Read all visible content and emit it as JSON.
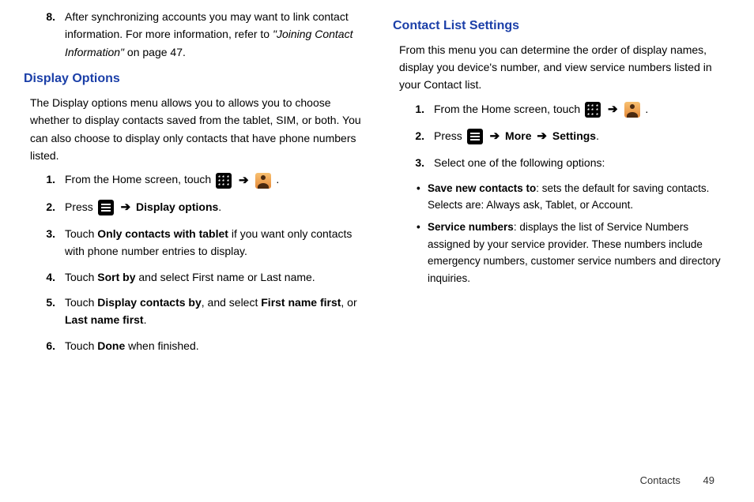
{
  "left": {
    "prestep_num": "8.",
    "prestep_a": "After synchronizing accounts you may want to link contact information. For more information, refer to ",
    "prestep_ref": "\"Joining Contact Information\"",
    "prestep_b": " on page 47.",
    "heading": "Display Options",
    "intro": "The Display options menu allows you to allows you to choose whether to display contacts saved from the tablet, SIM, or both. You can also choose to display only contacts that have phone numbers listed.",
    "s1_num": "1.",
    "s1_a": "From the Home screen, touch ",
    "arrow": "➔",
    "period": ".",
    "s2_num": "2.",
    "s2_a": "Press ",
    "s2_b": "Display options",
    "s3_num": "3.",
    "s3_a": "Touch ",
    "s3_b": "Only contacts with tablet",
    "s3_c": " if you want only contacts with phone number entries to display.",
    "s4_num": "4.",
    "s4_a": "Touch ",
    "s4_b": "Sort by",
    "s4_c": " and select First name or Last name.",
    "s5_num": "5.",
    "s5_a": "Touch ",
    "s5_b": "Display contacts by",
    "s5_c": ", and select ",
    "s5_d": "First name first",
    "s5_e": ", or ",
    "s5_f": "Last name first",
    "s5_g": ".",
    "s6_num": "6.",
    "s6_a": "Touch ",
    "s6_b": "Done",
    "s6_c": " when finished."
  },
  "right": {
    "heading": "Contact List Settings",
    "intro": "From this menu you can determine the order of display names, display you device's number, and view service numbers listed in your Contact list.",
    "s1_num": "1.",
    "s1_a": "From the Home screen, touch ",
    "arrow": "➔",
    "period": ".",
    "s2_num": "2.",
    "s2_a": "Press ",
    "s2_more": "More",
    "s2_settings": "Settings",
    "s3_num": "3.",
    "s3_a": "Select one of the following options:",
    "b1_label": "Save new contacts to",
    "b1_text": ": sets the default for saving contacts. Selects are: Always ask, Tablet, or Account.",
    "b2_label": "Service numbers",
    "b2_text": ": displays the list of Service Numbers assigned by your service provider. These numbers include emergency numbers, customer service numbers and directory inquiries."
  },
  "footer": {
    "section": "Contacts",
    "page": "49"
  }
}
